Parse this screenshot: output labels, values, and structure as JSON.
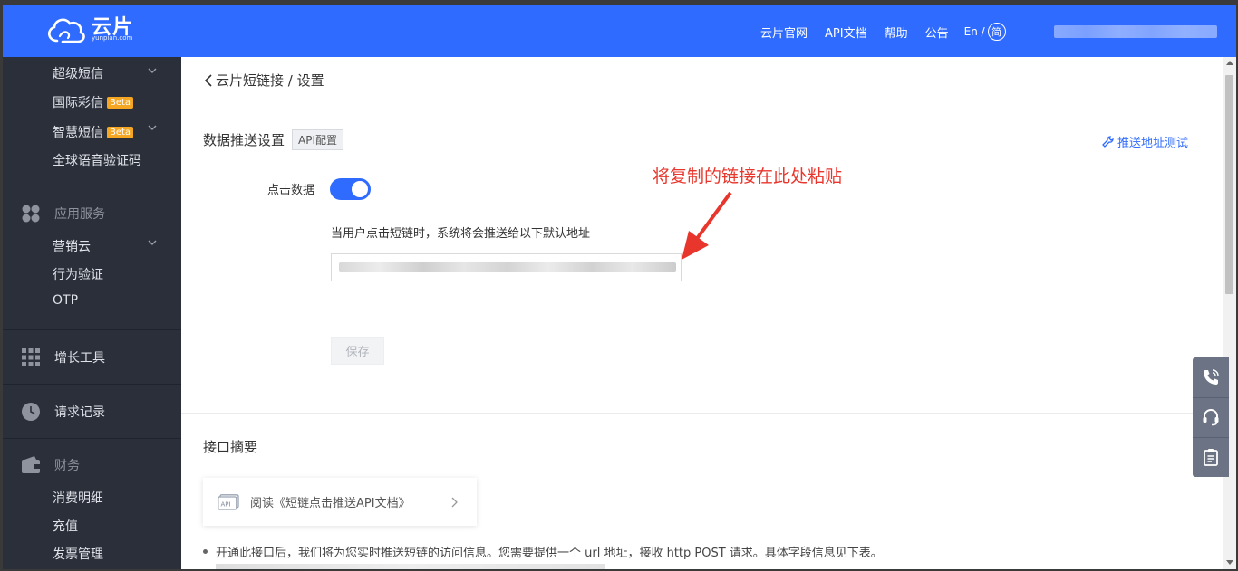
{
  "header": {
    "logo_text": "云片",
    "logo_sub": "yunpian.com",
    "nav": [
      "云片官网",
      "API文档",
      "帮助",
      "公告"
    ],
    "lang_en": "En /",
    "lang_cn": "简"
  },
  "sidebar": {
    "items": [
      {
        "label": "超级短信",
        "beta": null
      },
      {
        "label": "国际彩信",
        "beta": "Beta"
      },
      {
        "label": "智慧短信",
        "beta": "Beta"
      },
      {
        "label": "全球语音验证码",
        "beta": null
      }
    ],
    "sections": {
      "app_services": "应用服务",
      "app_items": [
        "营销云",
        "行为验证",
        "OTP"
      ],
      "growth": "增长工具",
      "requests": "请求记录",
      "finance": "财务",
      "finance_items": [
        "消费明细",
        "充值",
        "发票管理"
      ]
    }
  },
  "main": {
    "breadcrumb": "云片短链接 / 设置",
    "section_title": "数据推送设置",
    "api_tag": "API配置",
    "test_link": "推送地址测试",
    "toggle_label": "点击数据",
    "toggle_on": true,
    "description": "当用户点击短链时，系统将会推送给以下默认地址",
    "annotation": "将复制的链接在此处粘贴",
    "save_label": "保存",
    "summary_title": "接口摘要",
    "card_text": "阅读《短链点击推送API文档》",
    "note": "开通此接口后，我们将为您实时推送短链的访问信息。您需要提供一个 url 地址，接收 http POST 请求。具体字段信息见下表。"
  },
  "colors": {
    "brand": "#2f6bff",
    "sidebar_bg": "#2b2f3a",
    "annotation": "#e8362c",
    "beta": "#f5a623"
  }
}
